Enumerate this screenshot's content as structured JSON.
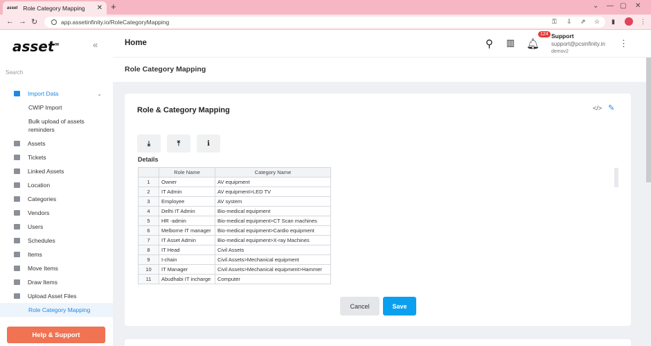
{
  "browser": {
    "tab_title": "Role Category Mapping",
    "tab_favicon_text": "asset",
    "url": "app.assetinfinity.io/RoleCategoryMapping"
  },
  "sidebar": {
    "logo": "asset",
    "search_placeholder": "Search",
    "items": [
      {
        "label": "Import Data",
        "icon": "file-import-icon",
        "active": true
      },
      {
        "label": "Assets",
        "icon": "monitor-icon"
      },
      {
        "label": "Tickets",
        "icon": "monitor-icon"
      },
      {
        "label": "Linked Assets",
        "icon": "link-icon"
      },
      {
        "label": "Location",
        "icon": "location-pin-icon"
      },
      {
        "label": "Categories",
        "icon": "grid-icon"
      },
      {
        "label": "Vendors",
        "icon": "user-add-icon"
      },
      {
        "label": "Users",
        "icon": "user-icon"
      },
      {
        "label": "Schedules",
        "icon": "calendar-icon"
      },
      {
        "label": "Items",
        "icon": "list-icon"
      },
      {
        "label": "Move Items",
        "icon": "truck-icon"
      },
      {
        "label": "Draw Items",
        "icon": "box-icon"
      },
      {
        "label": "Upload Asset Files",
        "icon": "file-upload-icon"
      }
    ],
    "import_sub": [
      "CWIP Import",
      "Bulk upload of assets reminders"
    ],
    "selected": "Role Category Mapping",
    "help_button": "Help & Support"
  },
  "header": {
    "title": "Home",
    "notification_count": "124",
    "user_name": "Support",
    "user_email": "support@pcsinfinity.in",
    "user_domain": "demov2"
  },
  "page": {
    "title": "Role Category Mapping",
    "card_title": "Role & Category Mapping",
    "details_label": "Details",
    "columns": [
      "Role Name",
      "Category Name"
    ],
    "rows": [
      {
        "n": "1",
        "role": "Owner",
        "category": "AV equipment"
      },
      {
        "n": "2",
        "role": "IT Admin",
        "category": "AV equipment>LED TV"
      },
      {
        "n": "3",
        "role": "Employee",
        "category": "AV system"
      },
      {
        "n": "4",
        "role": "Delhi IT Admin",
        "category": "Bio-medical equipment"
      },
      {
        "n": "5",
        "role": "HR -admin",
        "category": "Bio-medical equipment>CT Scan machines"
      },
      {
        "n": "6",
        "role": "Melborne IT manager",
        "category": "Bio-medical equipment>Cardio equipment"
      },
      {
        "n": "7",
        "role": "IT Asset Admin",
        "category": "Bio-medical equipment>X-ray Machines"
      },
      {
        "n": "8",
        "role": "IT Head",
        "category": "Civil Assets"
      },
      {
        "n": "9",
        "role": "I-chain",
        "category": "Civil Assets>Mechanical equipment"
      },
      {
        "n": "10",
        "role": "IT Manager",
        "category": "Civil Assets>Mechanical equipment>Hammer"
      },
      {
        "n": "11",
        "role": "Abudhabi IT incharge",
        "category": "Computer"
      }
    ],
    "cancel_button": "Cancel",
    "save_button": "Save"
  }
}
